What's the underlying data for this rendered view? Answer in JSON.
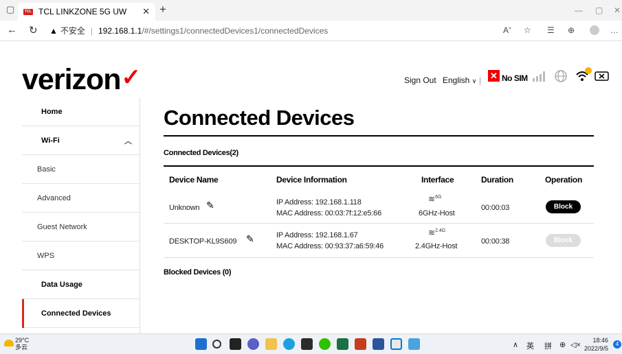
{
  "browser": {
    "tab_title": "TCL LINKZONE 5G UW",
    "favicon_text": "TCL",
    "insecure_label": "不安全",
    "url_host": "192.168.1.1",
    "url_path": "/#/settings1/connectedDevices1/connectedDevices"
  },
  "header": {
    "logo_text": "verizon",
    "sign_out": "Sign Out",
    "language": "English",
    "sim_status": "No SIM"
  },
  "sidebar": {
    "items": [
      {
        "label": "Home"
      },
      {
        "label": "Wi-Fi"
      },
      {
        "label": "Basic"
      },
      {
        "label": "Advanced"
      },
      {
        "label": "Guest Network"
      },
      {
        "label": "WPS"
      },
      {
        "label": "Data Usage"
      },
      {
        "label": "Connected Devices"
      }
    ]
  },
  "main": {
    "title": "Connected Devices",
    "connected_section": "Connected Devices(2)",
    "blocked_section": "Blocked Devices (0)",
    "columns": [
      "Device Name",
      "Device Information",
      "Interface",
      "Duration",
      "Operation"
    ],
    "devices": [
      {
        "name": "Unknown",
        "ip": "IP Address: 192.168.1.118",
        "mac": "MAC Address: 00:03:7f:12:e5:66",
        "band_badge": "6G",
        "interface": "6GHz-Host",
        "duration": "00:00:03",
        "operation": "Block",
        "operation_enabled": true
      },
      {
        "name": "DESKTOP-KL9S609",
        "ip": "IP Address: 192.168.1.67",
        "mac": "MAC Address: 00:93:37:a6:59:46",
        "band_badge": "2.4G",
        "interface": "2.4GHz-Host",
        "duration": "00:00:38",
        "operation": "Block",
        "operation_enabled": false
      }
    ]
  },
  "taskbar": {
    "temperature": "29°C",
    "weather": "多云",
    "ime_lang": "英",
    "ime_mode": "拼",
    "time": "18:46",
    "date": "2022/9/5",
    "notifications": "4"
  },
  "colors": {
    "brand_red": "#d52b1e",
    "block_active": "#000000",
    "block_disabled": "#dddddd"
  }
}
